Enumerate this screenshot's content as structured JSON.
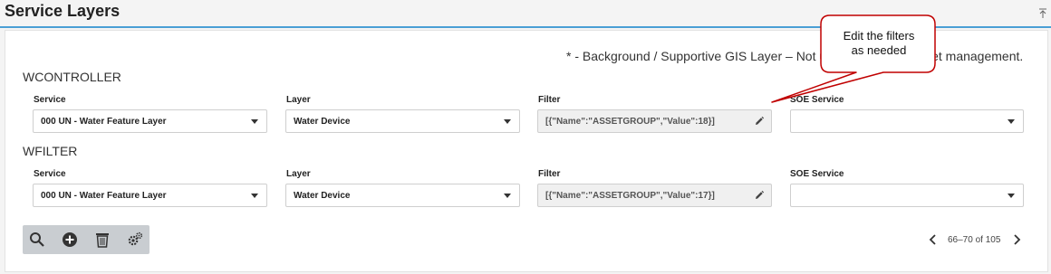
{
  "header": {
    "title": "Service Layers",
    "collapse_icon": "collapse-up-icon"
  },
  "note": "* - Background / Supportive GIS Layer – Not used in network asset management.",
  "callout": {
    "line1": "Edit the filters",
    "line2": "as needed",
    "border_color": "#c00000"
  },
  "labels": {
    "service": "Service",
    "layer": "Layer",
    "filter": "Filter",
    "soe_service": "SOE Service"
  },
  "groups": [
    {
      "name": "WCONTROLLER",
      "service": "000 UN - Water Feature Layer",
      "layer": "Water Device",
      "filter": "[{\"Name\":\"ASSETGROUP\",\"Value\":18}]",
      "soe_service": ""
    },
    {
      "name": "WFILTER",
      "service": "000 UN - Water Feature Layer",
      "layer": "Water Device",
      "filter": "[{\"Name\":\"ASSETGROUP\",\"Value\":17}]",
      "soe_service": ""
    }
  ],
  "toolbar": {
    "icons": [
      "search-icon",
      "add-icon",
      "delete-icon",
      "settings-icon"
    ]
  },
  "pager": {
    "text": "66–70 of 105"
  },
  "colors": {
    "accent": "#4a9fd5",
    "toolbar_bg": "#c9cdd1"
  }
}
